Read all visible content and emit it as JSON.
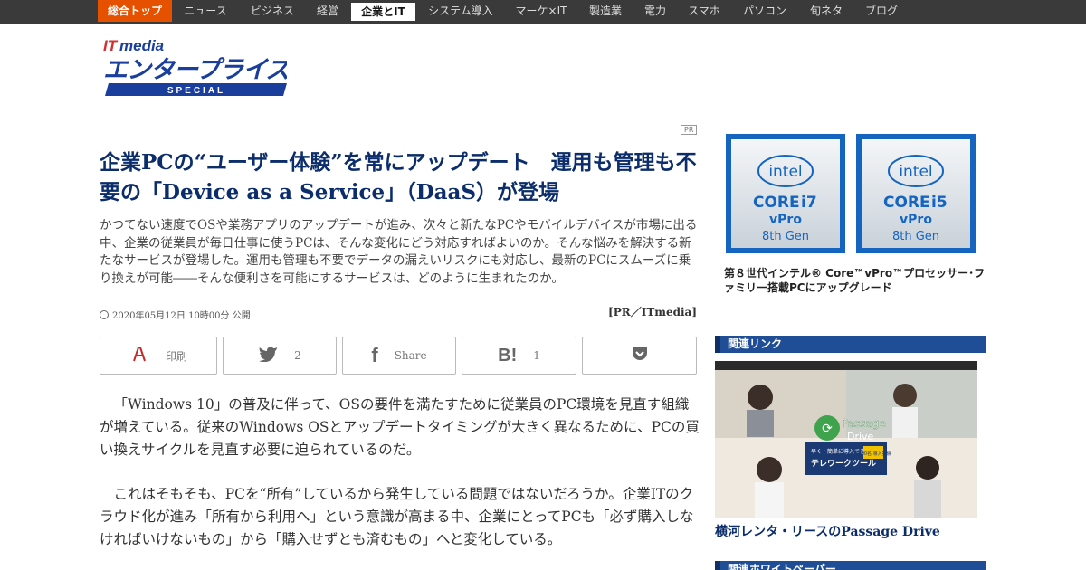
{
  "nav": {
    "items": [
      "総合トップ",
      "ニュース",
      "ビジネス",
      "経営",
      "企業とIT",
      "システム導入",
      "マーケ×IT",
      "製造業",
      "電力",
      "スマホ",
      "パソコン",
      "旬ネタ",
      "ブログ"
    ],
    "home_index": 0,
    "active_index": 4
  },
  "logo": {
    "brand": "ITmedia",
    "title": "エンタープライズ",
    "subtitle": "SPECIAL"
  },
  "article": {
    "pr_badge": "PR",
    "headline": "企業PCの“ユーザー体験”を常にアップデート　運用も管理も不要の「Device as a Service」（DaaS）が登場",
    "lead": "かつてない速度でOSや業務アプリのアップデートが進み、次々と新たなPCやモバイルデバイスが市場に出る中、企業の従業員が毎日仕事に使うPCは、そんな変化にどう対応すればよいのか。そんな悩みを解決する新たなサービスが登場した。運用も管理も不要でデータの漏えいリスクにも対応し、最新のPCにスムーズに乗り換えが可能――そんな便利さを可能にするサービスは、どのように生まれたのか。",
    "pubdate": "2020年05月12日 10時00分 公開",
    "credit": "[PR／ITmedia]",
    "paragraphs": [
      "「Windows 10」の普及に伴って、OSの要件を満たすために従業員のPC環境を見直す組織が増えている。従来のWindows OSとアップデートタイミングが大きく異なるために、PCの買い換えサイクルを見直す必要に迫られているのだ。",
      "これはそもそも、PCを“所有”しているから発生している問題ではないだろうか。企業ITのクラウド化が進み「所有から利用へ」という意識が高まる中、企業にとってPCも「必ず購入しなければいけないもの」から「購入せずとも済むもの」へと変化している。"
    ]
  },
  "share": {
    "print_label": "印刷",
    "twitter_count": "2",
    "facebook_label": "Share",
    "hatena_count": "1"
  },
  "sidebar": {
    "cpu_badges": [
      {
        "brand": "intel",
        "line": "CORE",
        "tier": "i7",
        "sub": "vPro",
        "gen": "8th Gen"
      },
      {
        "brand": "intel",
        "line": "CORE",
        "tier": "i5",
        "sub": "vPro",
        "gen": "8th Gen"
      }
    ],
    "cpu_caption": "第８世代インテル® Core™vPro™プロセッサー･ファミリー搭載PCにアップグレード",
    "related_links_title": "関連リンク",
    "promo_logo": "Passage Drive",
    "promo_banner_line1": "早く・簡単に導入できる",
    "promo_banner_line2": "テレワークツール",
    "promo_banner_badge": "1000名 導入実績",
    "promo_link": "横河レンタ・リースのPassage Drive",
    "whitepaper_title": "関連ホワイトペーパー"
  },
  "colors": {
    "nav_bg": "#3a3a3a",
    "home_accent": "#e65100",
    "headline": "#0b2d6b",
    "section_head": "#1f4e96",
    "logo_blue": "#1a3e9c"
  }
}
